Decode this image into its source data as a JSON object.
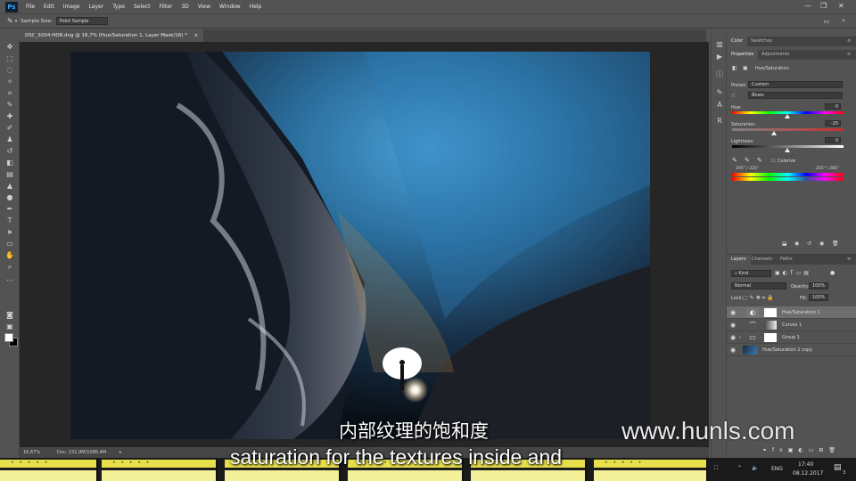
{
  "app": {
    "logo": "Ps"
  },
  "menu": [
    "File",
    "Edit",
    "Image",
    "Layer",
    "Type",
    "Select",
    "Filter",
    "3D",
    "View",
    "Window",
    "Help"
  ],
  "options_bar": {
    "sample_size_label": "Sample Size:",
    "sample_size_value": "Point Sample"
  },
  "document": {
    "tab_title": "DSC_9204-HDR.dng @ 16,7% (Hue/Saturation 1, Layer Mask/16) *",
    "close": "×"
  },
  "status": {
    "zoom": "16,67%",
    "doc_info": "Doc: 232,9M/1086,4M"
  },
  "panels": {
    "top_tabs": [
      "Color",
      "Swatches"
    ],
    "props_tabs": [
      "Properties",
      "Adjustments"
    ],
    "adjustment_title": "Hue/Saturation",
    "preset_label": "Preset:",
    "preset_value": "Custom",
    "channel_value": "Blues",
    "hue_label": "Hue:",
    "hue_value": "0",
    "saturation_label": "Saturation:",
    "saturation_value": "-25",
    "lightness_label": "Lightness:",
    "lightness_value": "0",
    "colorize_label": "Colorize",
    "range_left": "195° / 225°",
    "range_right": "255° \\ 285°"
  },
  "layers_panel": {
    "tabs": [
      "Layers",
      "Channels",
      "Paths"
    ],
    "kind_label": "Kind",
    "blend_mode": "Normal",
    "opacity_label": "Opacity:",
    "opacity_value": "100%",
    "lock_label": "Lock:",
    "fill_label": "Fill:",
    "fill_value": "100%",
    "layers": [
      {
        "name": "Hue/Saturation 1"
      },
      {
        "name": "Curves 1"
      },
      {
        "name": "Group 1"
      },
      {
        "name": "Hue/Saturation 1 copy"
      }
    ]
  },
  "taskbar": {
    "lang": "ENG",
    "time": "17:40",
    "date": "08.12.2017",
    "notif": "3"
  },
  "overlay": {
    "subtitle_cn": "内部纹理的饱和度",
    "subtitle_en": "saturation for the textures inside and",
    "watermark": "www.hunls.com"
  },
  "colors": {
    "ps_bg": "#535353",
    "canvas_bg": "#262626",
    "accent_yellow": "#e8e04a"
  }
}
